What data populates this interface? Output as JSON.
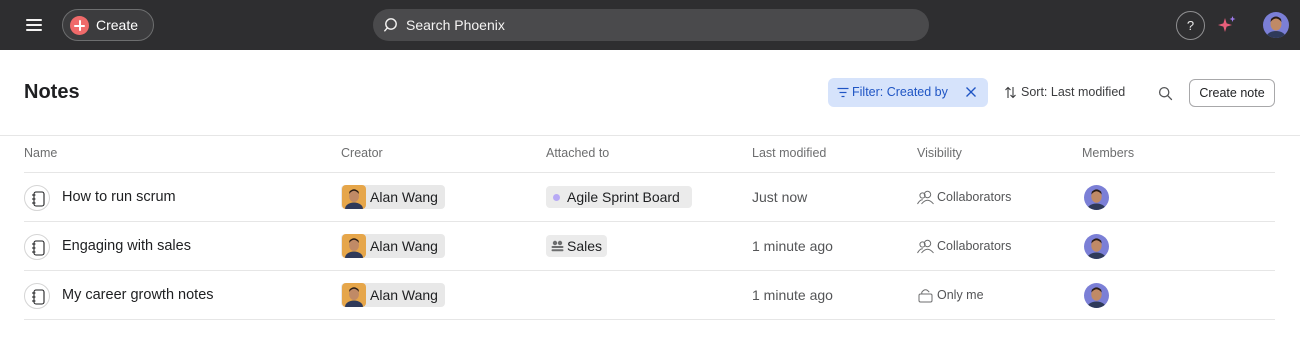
{
  "topbar": {
    "create_label": "Create",
    "search_placeholder": "Search Phoenix",
    "help_label": "?"
  },
  "header": {
    "title": "Notes",
    "filter_label": "Filter: Created by",
    "sort_label": "Sort: Last modified",
    "create_note_label": "Create note"
  },
  "columns": [
    "Name",
    "Creator",
    "Attached to",
    "Last modified",
    "Visibility",
    "Members"
  ],
  "rows": [
    {
      "name": "How to run scrum",
      "creator": "Alan Wang",
      "attached": "Agile Sprint Board",
      "attached_icon": "project-dot-icon",
      "modified": "Just now",
      "visibility": "Collaborators",
      "visibility_icon": "people-icon"
    },
    {
      "name": "Engaging with sales",
      "creator": "Alan Wang",
      "attached": "Sales",
      "attached_icon": "team-icon",
      "modified": "1 minute ago",
      "visibility": "Collaborators",
      "visibility_icon": "people-icon"
    },
    {
      "name": "My career growth notes",
      "creator": "Alan Wang",
      "attached": "",
      "attached_icon": "",
      "modified": "1 minute ago",
      "visibility": "Only me",
      "visibility_icon": "lock-icon"
    }
  ],
  "colors": {
    "topbar_bg": "#2e2e30",
    "create_accent": "#f06a6a",
    "filter_bg": "#d6e3fb",
    "filter_text": "#1f55c4",
    "project_dot": "#b7a9f5"
  }
}
